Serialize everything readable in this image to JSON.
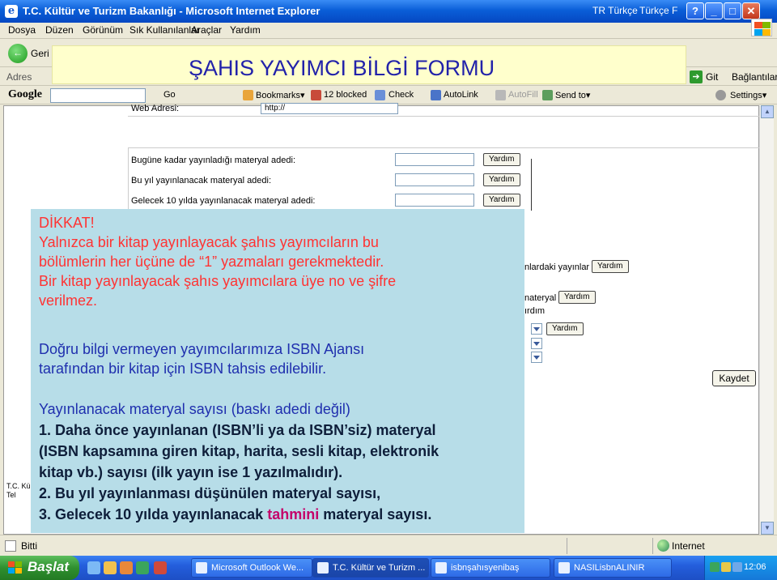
{
  "window": {
    "title": "T.C. Kültür ve Turizm Bakanlığı - Microsoft Internet Explorer",
    "lang_tr": "TR Türkçe",
    "lang_tf": "Türkçe F",
    "help_glyph": "?",
    "min_glyph": "_",
    "max_glyph": "□",
    "close_glyph": "✕"
  },
  "menu": [
    "Dosya",
    "Düzen",
    "Görünüm",
    "Sık Kullanılanlar",
    "Araçlar",
    "Yardım"
  ],
  "toolbar": {
    "back_label": "Geri"
  },
  "addressbar": {
    "label": "Adres",
    "go_label": "Git",
    "links_label": "Bağlantılar"
  },
  "googlebar": {
    "logo": "Google",
    "go": "Go",
    "bookmarks": "Bookmarks▾",
    "blocked": "12 blocked",
    "check": "Check",
    "autolink": "AutoLink",
    "autofill": "AutoFill",
    "sendto": "Send to▾",
    "settings": "Settings▾"
  },
  "banner": {
    "title": "ŞAHIS YAYIMCI BİLGİ FORMU"
  },
  "form": {
    "web_label": "Web Adresi:",
    "web_value": "http://",
    "rows": [
      {
        "label": "Bugüne kadar yayınladığı materyal adedi:",
        "help": "Yardım"
      },
      {
        "label": "Bu yıl yayınlanacak materyal adedi:",
        "help": "Yardım"
      },
      {
        "label": "Gelecek 10 yılda yayınlanacak materyal adedi:",
        "help": "Yardım"
      }
    ],
    "frag1_label": "nlardaki yayınlar",
    "frag1_help": "Yardım",
    "frag2_label": "nateryal",
    "frag2_help": "Yardım",
    "frag3_label": "ırdım",
    "frag4_help": "Yardım",
    "save_label": "Kaydet",
    "logo_fragment": "T.C. Kü\nTel"
  },
  "note": {
    "warning_title": "DİKKAT!",
    "warning_lines": [
      "Yalnızca bir kitap yayınlayacak şahıs yayımcıların bu",
      "bölümlerin her üçüne de “1” yazmaları gerekmektedir.",
      "Bir kitap yayınlayacak şahıs yayımcılara üye no ve şifre",
      "verilmez."
    ],
    "isbn_lines": [
      "Doğru bilgi vermeyen yayımcılarımıza ISBN Ajansı",
      "tarafından bir kitap için ISBN tahsis edilebilir."
    ],
    "count_heading": "Yayınlanacak materyal sayısı (baskı adedi değil)",
    "items": [
      "1. Daha önce  yayınlanan (ISBN’li ya da ISBN’siz)  materyal",
      "(ISBN kapsamına giren kitap, harita, sesli kitap, elektronik",
      "kitap vb.) sayısı  (ilk yayın ise 1 yazılmalıdır).",
      "2. Bu yıl yayınlanması düşünülen materyal sayısı,"
    ],
    "item3_before": "3. Gelecek 10 yılda yayınlanacak ",
    "item3_accent": "tahmini",
    "item3_after": " materyal sayısı."
  },
  "status": {
    "done": "Bitti",
    "zone": "Internet"
  },
  "taskbar": {
    "start": "Başlat",
    "tasks": [
      "Microsoft Outlook We...",
      "T.C. Kültür ve Turizm ...",
      "isbnşahısyenibaş",
      "NASILisbnALINIR"
    ],
    "clock": "12:06"
  },
  "colors": {
    "banner_bg": "#FFFFCC",
    "banner_text": "#2222AA",
    "note_bg": "#B7DDE8",
    "warning_red": "#FF3333",
    "note_blue": "#1F2FAE",
    "accent": "#C4006A"
  }
}
